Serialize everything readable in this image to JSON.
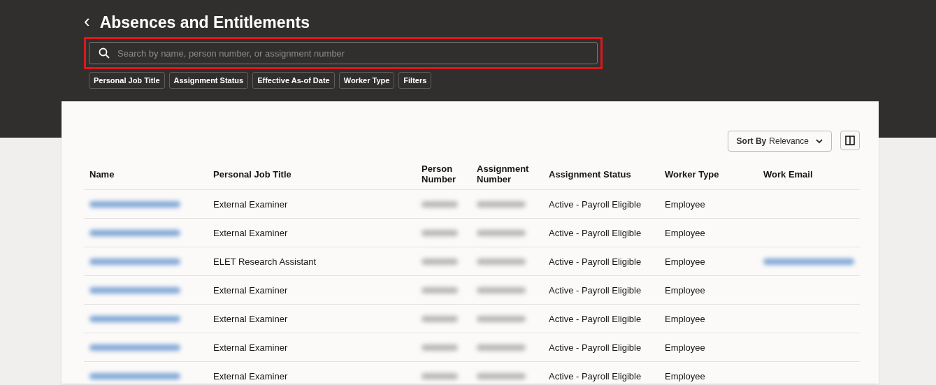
{
  "page": {
    "back": "‹",
    "title": "Absences and Entitlements"
  },
  "search": {
    "placeholder": "Search by name, person number, or assignment number",
    "highlighted": true
  },
  "filter_chips": [
    "Personal Job Title",
    "Assignment Status",
    "Effective As-of Date",
    "Worker Type",
    "Filters"
  ],
  "sort": {
    "prefix": "Sort By",
    "value": "Relevance"
  },
  "table": {
    "columns": [
      "Name",
      "Personal Job Title",
      "Person Number",
      "Assignment Number",
      "Assignment Status",
      "Worker Type",
      "Work Email"
    ],
    "rows": [
      {
        "cells": [
          {
            "kind": "redacted"
          },
          {
            "kind": "text",
            "text": "External Examiner"
          },
          {
            "kind": "redacted"
          },
          {
            "kind": "redacted"
          },
          {
            "kind": "text",
            "text": "Active - Payroll Eligible"
          },
          {
            "kind": "text",
            "text": "Employee"
          },
          {
            "kind": "empty"
          }
        ]
      },
      {
        "cells": [
          {
            "kind": "redacted"
          },
          {
            "kind": "text",
            "text": "External Examiner"
          },
          {
            "kind": "redacted"
          },
          {
            "kind": "redacted"
          },
          {
            "kind": "text",
            "text": "Active - Payroll Eligible"
          },
          {
            "kind": "text",
            "text": "Employee"
          },
          {
            "kind": "empty"
          }
        ]
      },
      {
        "cells": [
          {
            "kind": "redacted"
          },
          {
            "kind": "text",
            "text": "ELET Research Assistant"
          },
          {
            "kind": "redacted"
          },
          {
            "kind": "redacted"
          },
          {
            "kind": "text",
            "text": "Active - Payroll Eligible"
          },
          {
            "kind": "text",
            "text": "Employee"
          },
          {
            "kind": "redacted"
          }
        ]
      },
      {
        "cells": [
          {
            "kind": "redacted"
          },
          {
            "kind": "text",
            "text": "External Examiner"
          },
          {
            "kind": "redacted"
          },
          {
            "kind": "redacted"
          },
          {
            "kind": "text",
            "text": "Active - Payroll Eligible"
          },
          {
            "kind": "text",
            "text": "Employee"
          },
          {
            "kind": "empty"
          }
        ]
      },
      {
        "cells": [
          {
            "kind": "redacted"
          },
          {
            "kind": "text",
            "text": "External Examiner"
          },
          {
            "kind": "redacted"
          },
          {
            "kind": "redacted"
          },
          {
            "kind": "text",
            "text": "Active - Payroll Eligible"
          },
          {
            "kind": "text",
            "text": "Employee"
          },
          {
            "kind": "empty"
          }
        ]
      },
      {
        "cells": [
          {
            "kind": "redacted"
          },
          {
            "kind": "text",
            "text": "External Examiner"
          },
          {
            "kind": "redacted"
          },
          {
            "kind": "redacted"
          },
          {
            "kind": "text",
            "text": "Active - Payroll Eligible"
          },
          {
            "kind": "text",
            "text": "Employee"
          },
          {
            "kind": "empty"
          }
        ]
      },
      {
        "cells": [
          {
            "kind": "redacted"
          },
          {
            "kind": "text",
            "text": "External Examiner"
          },
          {
            "kind": "redacted"
          },
          {
            "kind": "redacted"
          },
          {
            "kind": "text",
            "text": "Active - Payroll Eligible"
          },
          {
            "kind": "text",
            "text": "Employee"
          },
          {
            "kind": "empty"
          }
        ]
      }
    ]
  }
}
